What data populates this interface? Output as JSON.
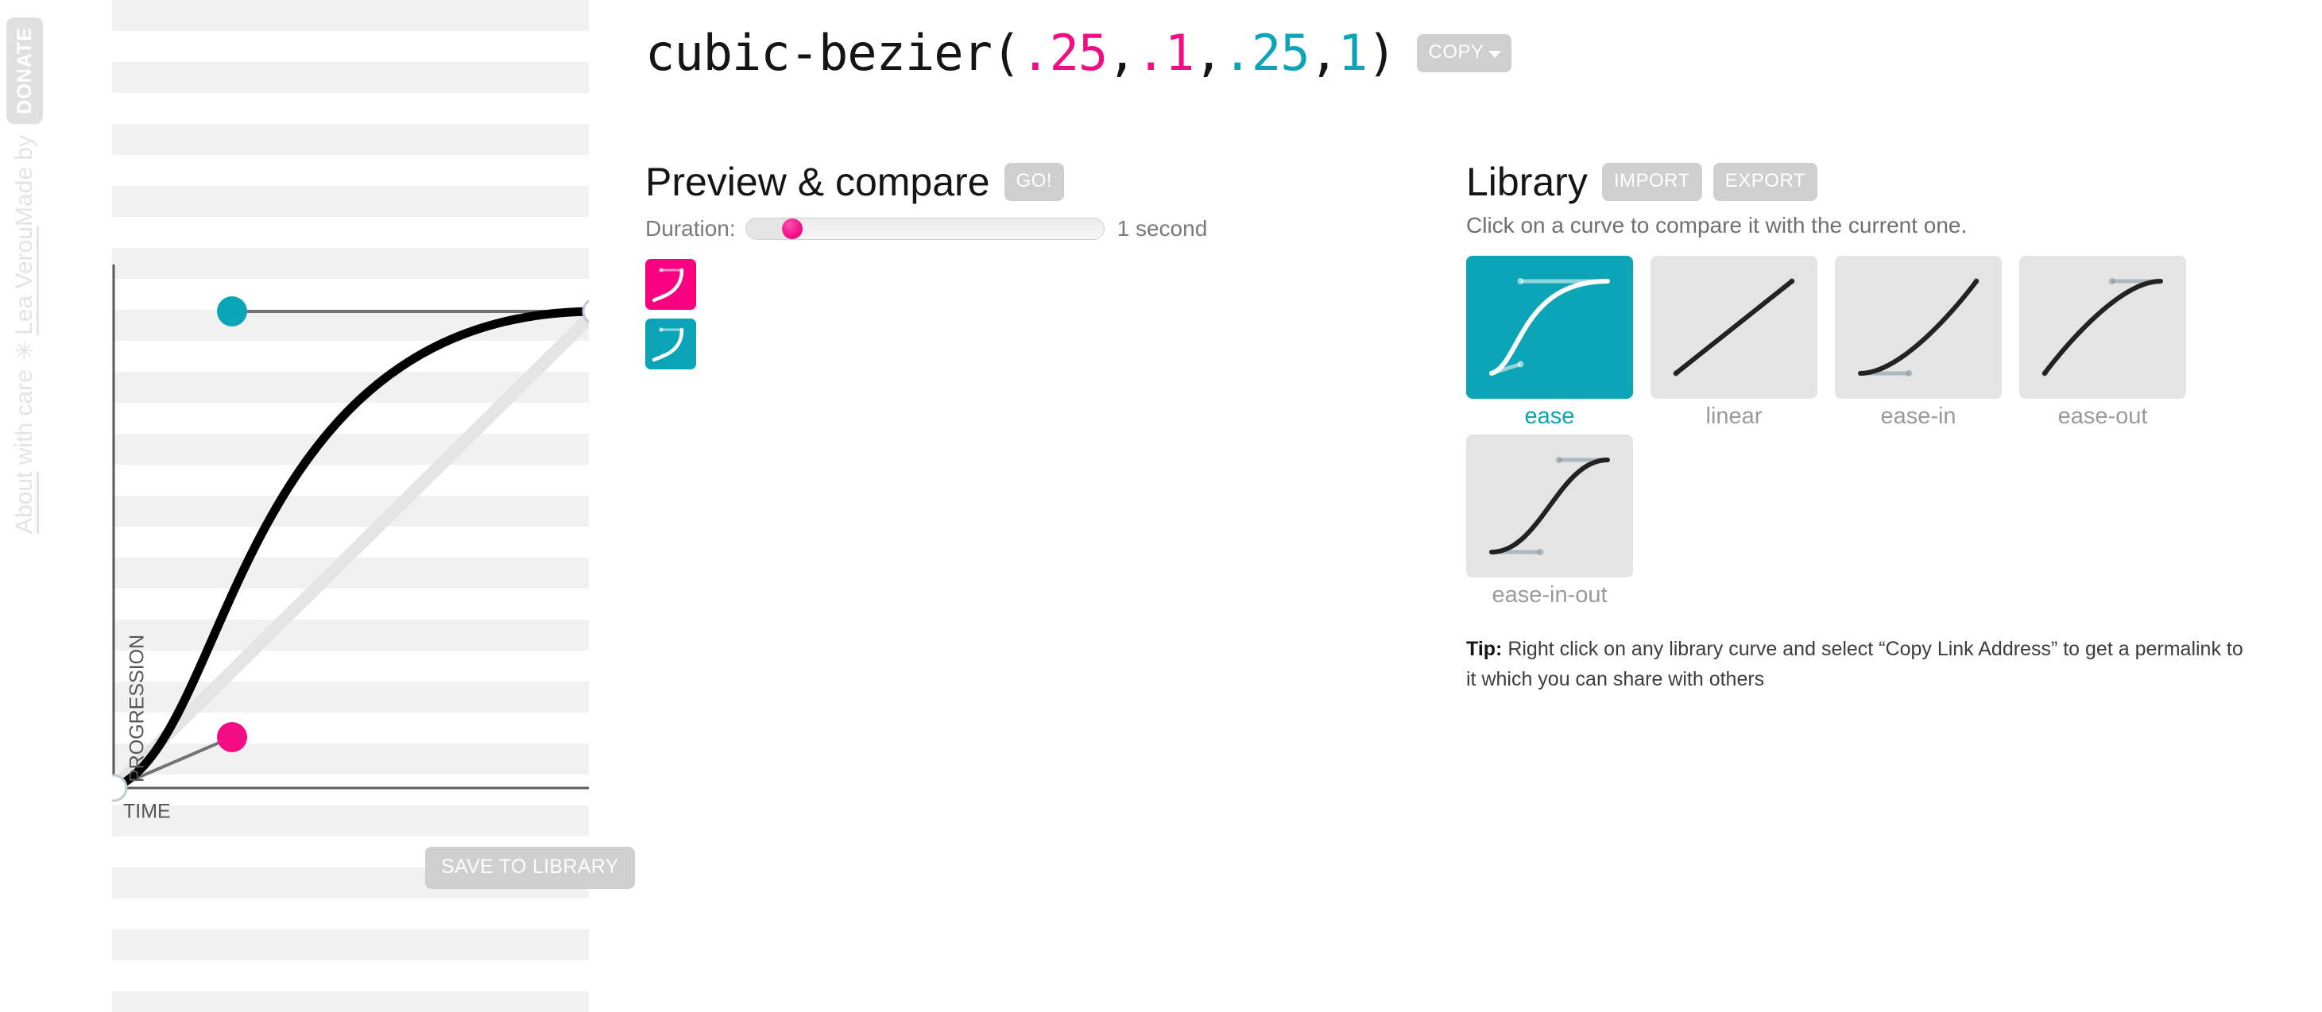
{
  "rail": {
    "donate_label": "DONATE",
    "about_label": "About",
    "credit_prefix": "Made by ",
    "credit_author": "Lea Verou",
    "credit_suffix": " with care ✳"
  },
  "header": {
    "function_name": "cubic-bezier(",
    "p1x": ".25",
    "comma1": ",",
    "p1y": ".1",
    "comma2": ",",
    "p2x": ".25",
    "comma3": ",",
    "p2y": "1",
    "close_paren": ")",
    "copy_label": "COPY"
  },
  "editor": {
    "x_axis_label": "TIME",
    "y_axis_label": "PROGRESSION",
    "save_label": "SAVE TO LIBRARY",
    "handle_p1_color": "#f20d84",
    "handle_p2_color": "#0ba5b7"
  },
  "preview": {
    "title": "Preview & compare",
    "go_label": "GO!",
    "duration_label": "Duration:",
    "duration_value": "1 second",
    "duration_percent": 10,
    "swatches": [
      {
        "name": "current-curve-preview",
        "color": "#f90080"
      },
      {
        "name": "compare-curve-preview",
        "color": "#0ba5b7"
      }
    ]
  },
  "library": {
    "title": "Library",
    "import_label": "IMPORT",
    "export_label": "EXPORT",
    "subtitle": "Click on a curve to compare it with the current one.",
    "items": [
      {
        "label": "ease",
        "selected": true,
        "p": [
          0.25,
          0.1,
          0.25,
          1
        ]
      },
      {
        "label": "linear",
        "selected": false,
        "p": [
          0,
          0,
          1,
          1
        ]
      },
      {
        "label": "ease-in",
        "selected": false,
        "p": [
          0.42,
          0,
          1,
          1
        ]
      },
      {
        "label": "ease-out",
        "selected": false,
        "p": [
          0,
          0,
          0.58,
          1
        ]
      },
      {
        "label": "ease-in-out",
        "selected": false,
        "p": [
          0.42,
          0,
          0.58,
          1
        ]
      }
    ],
    "tip_prefix": "Tip:",
    "tip_text": " Right click on any library curve and select “Copy Link Address” to get a permalink to it which you can share with others"
  },
  "chart_data": {
    "type": "line",
    "title": "cubic-bezier(.25,.1,.25,1)",
    "xlabel": "TIME",
    "ylabel": "PROGRESSION",
    "xlim": [
      0,
      1
    ],
    "ylim": [
      0,
      1
    ],
    "grid": "horizontal-stripes",
    "control_points": {
      "start": [
        0,
        0
      ],
      "p1": [
        0.25,
        0.1
      ],
      "p2": [
        0.25,
        1
      ],
      "end": [
        1,
        1
      ]
    },
    "series": [
      {
        "name": "cubic-bezier curve",
        "color": "#000000"
      },
      {
        "name": "linear reference",
        "color": "#e4e4e4"
      }
    ]
  }
}
